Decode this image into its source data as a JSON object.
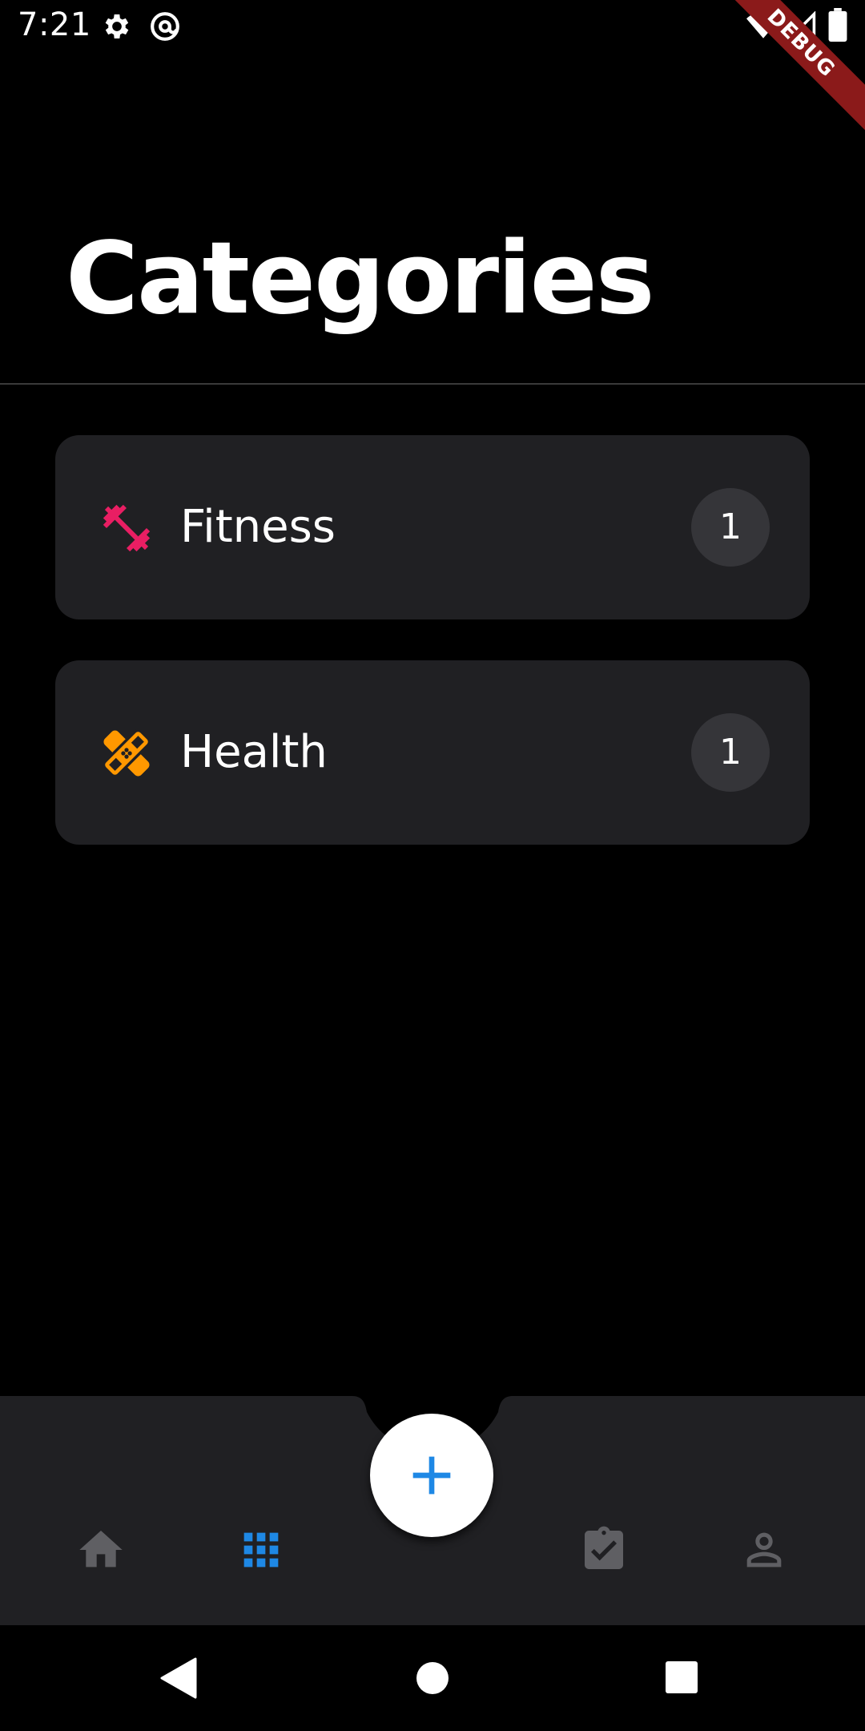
{
  "status_bar": {
    "time": "7:21",
    "left_icons": [
      "gear-icon",
      "at-sign-icon"
    ],
    "right_icons": [
      "wifi-icon",
      "signal-icon",
      "battery-icon"
    ],
    "debug_banner": "DEBUG"
  },
  "header": {
    "title": "Categories"
  },
  "categories": [
    {
      "label": "Fitness",
      "count": "1",
      "icon": "dumbbell-icon",
      "icon_color": "#e91e63"
    },
    {
      "label": "Health",
      "count": "1",
      "icon": "bandage-icon",
      "icon_color": "#ff9800"
    }
  ],
  "bottom_nav": {
    "items": [
      {
        "icon": "home-icon",
        "active": false
      },
      {
        "icon": "grid-icon",
        "active": true
      },
      {
        "icon": "clipboard-check-icon",
        "active": false
      },
      {
        "icon": "person-icon",
        "active": false
      }
    ],
    "fab_icon": "plus-icon",
    "active_color": "#1e88e5",
    "inactive_color": "#5f5f63"
  },
  "system_nav": [
    "back-icon",
    "home-circle-icon",
    "recents-icon"
  ],
  "colors": {
    "background": "#000000",
    "card": "#202023",
    "badge": "#353539",
    "nav_bar": "#202023"
  }
}
